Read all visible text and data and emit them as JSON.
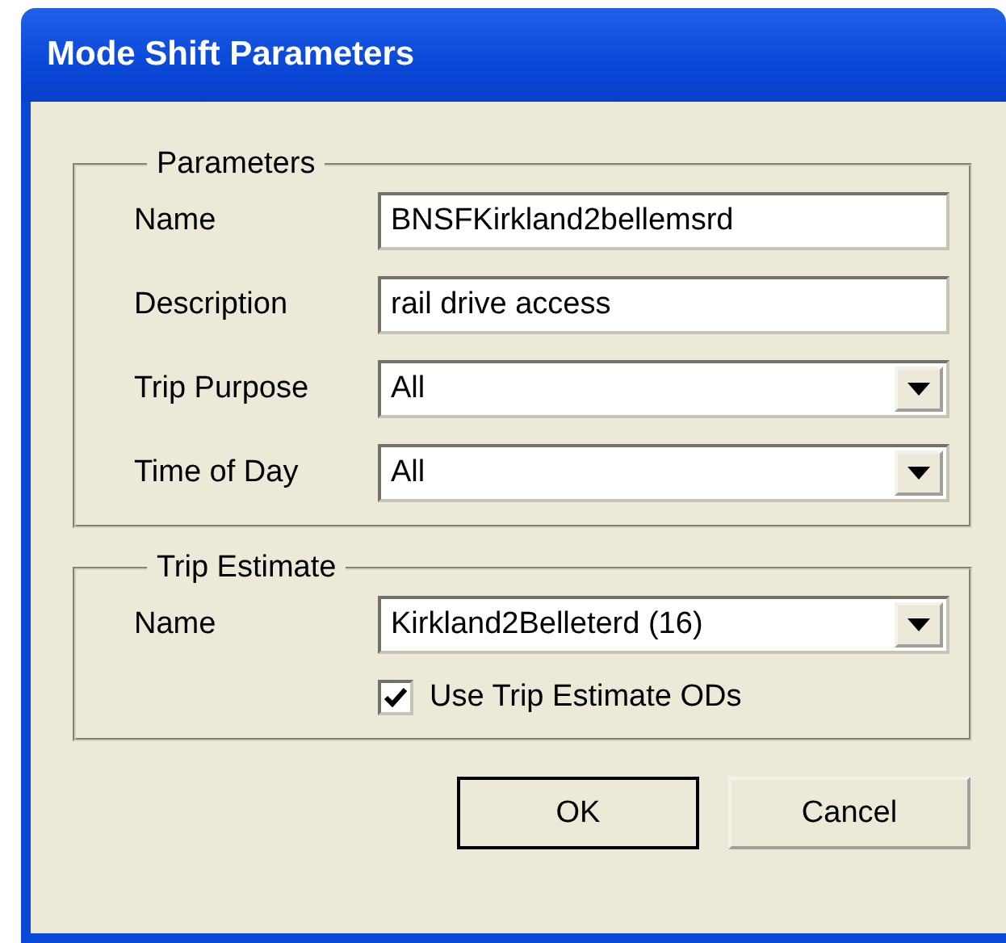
{
  "window": {
    "title": "Mode Shift Parameters"
  },
  "groups": [
    {
      "title": "Parameters",
      "rows": [
        {
          "kind": "text",
          "label": "Name",
          "value": "BNSFKirkland2bellemsrd"
        },
        {
          "kind": "text",
          "label": "Description",
          "value": "rail drive access"
        },
        {
          "kind": "combo",
          "label": "Trip Purpose",
          "value": "All"
        },
        {
          "kind": "combo",
          "label": "Time of Day",
          "value": "All"
        }
      ]
    },
    {
      "title": "Trip Estimate",
      "rows": [
        {
          "kind": "combo",
          "label": "Name",
          "value": "Kirkland2Belleterd (16)"
        },
        {
          "kind": "checkbox",
          "label": "Use Trip Estimate ODs",
          "checked": true
        }
      ]
    }
  ],
  "buttons": [
    {
      "label": "OK",
      "default": true
    },
    {
      "label": "Cancel",
      "default": false
    }
  ]
}
